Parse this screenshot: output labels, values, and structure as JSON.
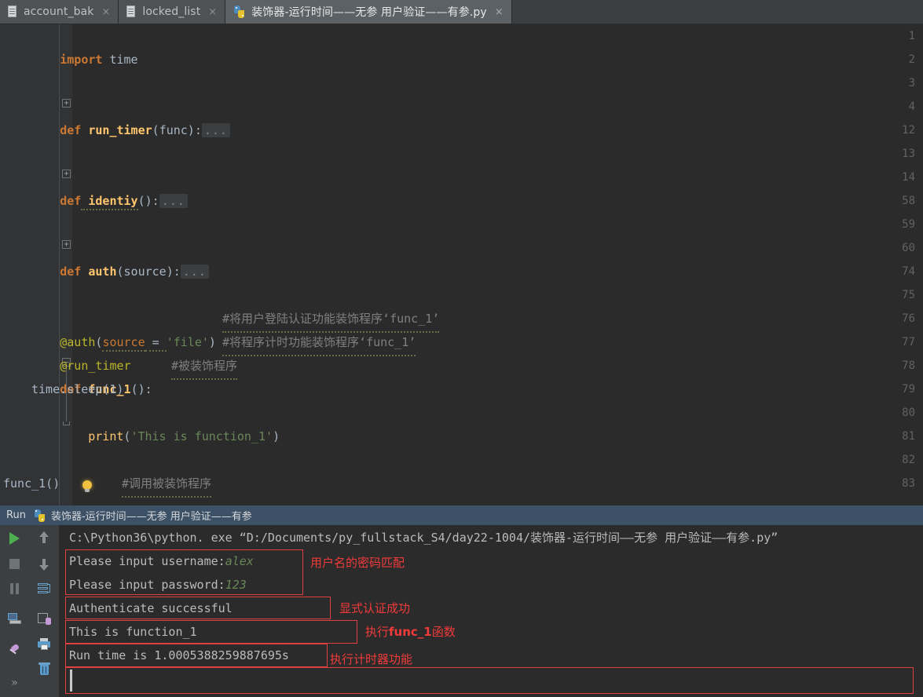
{
  "window": {
    "title": "PyCharm editor - 装饰器-运行时间——无参 用户验证——有参.py"
  },
  "tabs": [
    {
      "label": "account_bak",
      "icon": "file-icon",
      "close": "×",
      "active": false
    },
    {
      "label": "locked_list",
      "icon": "file-icon",
      "close": "×",
      "active": false
    },
    {
      "label": "装饰器-运行时间——无参 用户验证——有参.py",
      "icon": "python-file-icon",
      "close": "×",
      "active": true
    }
  ],
  "editor": {
    "lines": [
      {
        "num": "1",
        "fold": "none"
      },
      {
        "num": "2",
        "fold": "none"
      },
      {
        "num": "3",
        "fold": "none"
      },
      {
        "num": "4",
        "fold": "plus"
      },
      {
        "num": "12",
        "fold": "none"
      },
      {
        "num": "13",
        "fold": "none"
      },
      {
        "num": "14",
        "fold": "plus"
      },
      {
        "num": "58",
        "fold": "none"
      },
      {
        "num": "59",
        "fold": "none"
      },
      {
        "num": "60",
        "fold": "plus"
      },
      {
        "num": "74",
        "fold": "none"
      },
      {
        "num": "75",
        "fold": "none"
      },
      {
        "num": "76",
        "fold": "none"
      },
      {
        "num": "77",
        "fold": "none"
      },
      {
        "num": "78",
        "fold": "minus"
      },
      {
        "num": "79",
        "fold": "none"
      },
      {
        "num": "80",
        "fold": "end"
      },
      {
        "num": "81",
        "fold": "none"
      },
      {
        "num": "82",
        "fold": "none"
      },
      {
        "num": "83",
        "fold": "none"
      }
    ],
    "code": {
      "l1_import": "import",
      "l1_module": " time",
      "l4_def": "def",
      "l4_name": " run_timer",
      "l4_args": "(func):",
      "l4_fold": "...",
      "l14_def": "def",
      "l14_name": " identiy",
      "l14_args": "():",
      "l14_fold": "...",
      "l60_def": "def",
      "l60_name": " auth",
      "l60_args": "(source):",
      "l60_fold": "...",
      "l76_dec": "@auth",
      "l76_open": "(",
      "l76_arg": "source",
      "l76_eq": " = ",
      "l76_str": "'file'",
      "l76_close": ")",
      "l76_comment": "#将用户登陆认证功能装饰程序‘func_1’",
      "l77_dec": "@run_timer",
      "l77_comment": "#将程序计时功能装饰程序‘func_1’",
      "l78_def": "def",
      "l78_name": " func_1",
      "l78_args": "():",
      "l78_comment": "#被装饰程序",
      "l79_code": "time.sleep(1)",
      "l80_fn": "print",
      "l80_open": "(",
      "l80_str": "'This is function_1'",
      "l80_close": ")",
      "l83_call": "func_1()",
      "l83_comment": "#调用被装饰程序"
    }
  },
  "run_panel": {
    "tool_label": "Run",
    "config_name": "装饰器-运行时间——无参 用户验证——有参",
    "toolbar_left": [
      {
        "name": "rerun-button",
        "icon": "play-icon"
      },
      {
        "name": "stop-button",
        "icon": "stop-square-icon"
      },
      {
        "name": "pause-button",
        "icon": "pause-icon"
      },
      {
        "name": "show-console-button",
        "icon": "console-icon"
      },
      {
        "name": "pin-tab-button",
        "icon": "pin-icon"
      },
      {
        "name": "expand-more-button",
        "icon": "chevron-double-right-icon",
        "glyph": "»"
      }
    ],
    "toolbar_right": [
      {
        "name": "up-the-stack-trace-button",
        "icon": "arrow-up-icon"
      },
      {
        "name": "down-the-stack-trace-button",
        "icon": "arrow-down-icon"
      },
      {
        "name": "soft-wrap-button",
        "icon": "soft-wrap-icon"
      },
      {
        "name": "export-button",
        "icon": "export-icon"
      },
      {
        "name": "print-button",
        "icon": "print-icon"
      },
      {
        "name": "clear-all-button",
        "icon": "trash-icon"
      }
    ],
    "console": {
      "command_line": "C:\\Python36\\python. exe “D:/Documents/py_fullstack_S4/day22-1004/装饰器-运行时间——无参 用户验证——有参.py”",
      "lines": [
        {
          "prompt": "Please input username:",
          "value": "alex"
        },
        {
          "prompt": "Please input password:",
          "value": "123"
        },
        {
          "prompt": "Authenticate successful",
          "value": ""
        },
        {
          "prompt": "This is function_1",
          "value": ""
        },
        {
          "prompt": "Run time is 1.0005388259887695s",
          "value": ""
        }
      ]
    },
    "annotations": [
      {
        "text": "用户名的密码匹配",
        "bold": ""
      },
      {
        "text": "显式认证成功",
        "bold": ""
      },
      {
        "pre": "执行",
        "bold": "func_1",
        "post": "函数"
      },
      {
        "text": "执行计时器功能",
        "bold": ""
      }
    ]
  },
  "colors": {
    "editor_bg": "#2b2b2b",
    "gutter_bg": "#313335",
    "tab_bg": "#3c3f41",
    "run_header_bg": "#3c5066",
    "keyword": "#cc7832",
    "function": "#ffc66d",
    "string": "#6a8759",
    "comment": "#808080",
    "decorator": "#bbb529",
    "text": "#a9b7c6",
    "annotation_red": "#f23a3a",
    "console_text": "#bbbbbb",
    "input_echo": "#6a8759",
    "run_play_green": "#4caf50"
  }
}
